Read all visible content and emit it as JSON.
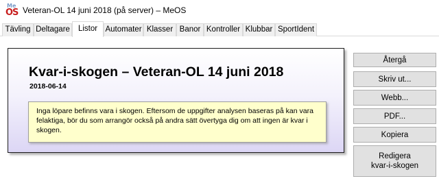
{
  "window": {
    "title": "Veteran-OL 14 juni 2018 (på server) – MeOS",
    "icon_label_top": "Me",
    "icon_label_bottom": "OS"
  },
  "tabs": [
    {
      "label": "Tävling",
      "active": false
    },
    {
      "label": "Deltagare",
      "active": false
    },
    {
      "label": "Listor",
      "active": true
    },
    {
      "label": "Automater",
      "active": false
    },
    {
      "label": "Klasser",
      "active": false
    },
    {
      "label": "Banor",
      "active": false
    },
    {
      "label": "Kontroller",
      "active": false
    },
    {
      "label": "Klubbar",
      "active": false
    },
    {
      "label": "SportIdent",
      "active": false
    }
  ],
  "report": {
    "title": "Kvar-i-skogen – Veteran-OL 14 juni 2018",
    "date": "2018-06-14",
    "notice": "Inga löpare befinns vara i skogen. Eftersom de uppgifter analysen baseras på kan vara felaktiga, bör du som arrangör också på andra sätt övertyga dig om att ingen är kvar i skogen."
  },
  "buttons": {
    "back": "Återgå",
    "print": "Skriv ut...",
    "web": "Webb...",
    "pdf": "PDF...",
    "copy": "Kopiera",
    "edit_line1": "Redigera",
    "edit_line2": "kvar-i-skogen"
  },
  "colors": {
    "icon_red": "#c81e1e",
    "notice_bg": "#ffffcc",
    "panel_gradient_end": "#dcd6f5",
    "button_bg": "#e1e1e1"
  }
}
